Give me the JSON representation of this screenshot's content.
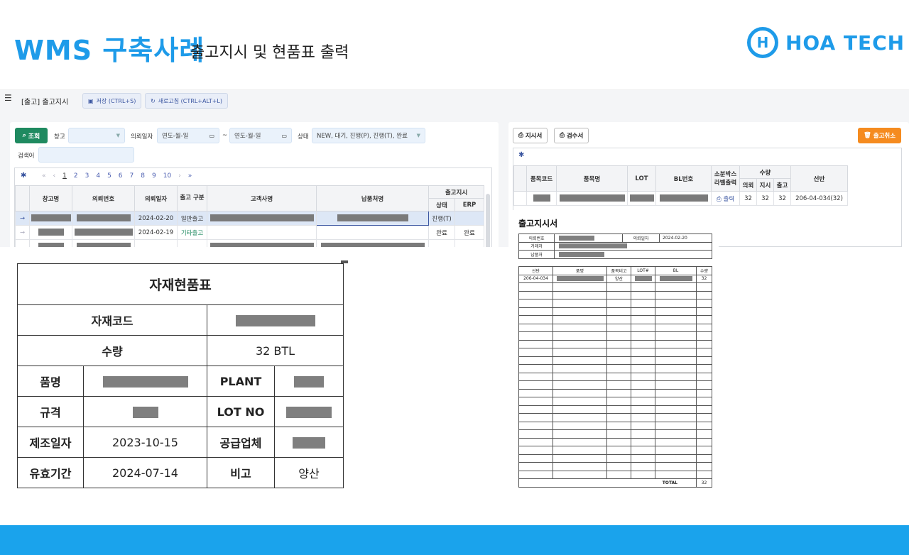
{
  "header": {
    "title_main": "WMS 구축사례",
    "title_sub": "출고지시 및 현품표 출력",
    "logo_mark": "H",
    "logo_text": "HOA TECH"
  },
  "app": {
    "menu_icon": "☰",
    "screen_title": "[출고] 출고지시",
    "save_label": "저장 (CTRL+S)",
    "refresh_label": "새로고침 (CTRL+ALT+L)",
    "search_button": "조회",
    "warehouse_label": "창고",
    "request_date_label": "의뢰일자",
    "date_placeholder_from": "연도-월-일",
    "date_tilde": "~",
    "date_placeholder_to": "연도-월-일",
    "status_label": "상태",
    "status_value": "NEW, 대기, 진행(P), 진행(T), 완료",
    "keyword_label": "검색어",
    "pager": {
      "first": "«",
      "prev": "‹",
      "pages": [
        "1",
        "2",
        "3",
        "4",
        "5",
        "6",
        "7",
        "8",
        "9",
        "10"
      ],
      "next": "›",
      "last": "»"
    },
    "left_table": {
      "headers": {
        "warehouse": "창고명",
        "request_no": "의뢰번호",
        "request_date": "의뢰일자",
        "ship_type": "출고 구분",
        "customer": "고객사명",
        "delivery": "납품처명",
        "ship_instr": "출고지시",
        "status": "상태",
        "erp": "ERP"
      },
      "rows": [
        {
          "date": "2024-02-20",
          "type": "일반출고",
          "status": "진행(T)",
          "erp": ""
        },
        {
          "date": "2024-02-19",
          "type": "기타출고",
          "status": "완료",
          "erp": "완료"
        }
      ]
    },
    "right_buttons": {
      "instr_print": "지시서",
      "inspect_print": "검수서",
      "cancel": "출고취소"
    },
    "right_table": {
      "headers": {
        "code": "품목코드",
        "name": "품목명",
        "lot": "LOT",
        "bl": "BL번호",
        "small_box": "소분박스 라벨출력",
        "qty": "수량",
        "req": "의뢰",
        "ins": "지시",
        "out": "출고",
        "shelf": "선반"
      },
      "row": {
        "print": "출력",
        "req": "32",
        "ins": "32",
        "out": "32",
        "shelf": "206-04-034(32)"
      }
    }
  },
  "material_label": {
    "title": "자재현품표",
    "code_label": "자재코드",
    "qty_label": "수량",
    "qty_value": "32 BTL",
    "name_label": "품명",
    "plant_label": "PLANT",
    "spec_label": "규격",
    "lot_label": "LOT NO",
    "mfg_label": "제조일자",
    "mfg_value": "2023-10-15",
    "supplier_label": "공급업체",
    "expiry_label": "유효기간",
    "expiry_value": "2024-07-14",
    "remark_label": "비고",
    "remark_value": "양산"
  },
  "order_sheet": {
    "title": "출고지시서",
    "req_no_label": "의뢰번호",
    "req_date_label": "의뢰일자",
    "req_date_value": "2024-02-20",
    "client_label": "거래처",
    "dest_label": "납품처",
    "cols": [
      "선반",
      "품명",
      "품목비고",
      "LOT#",
      "BL",
      "수량"
    ],
    "first_row": {
      "shelf": "206-04-034",
      "remark": "양산",
      "qty": "32"
    },
    "total_label": "TOTAL",
    "total_value": "32"
  },
  "colors": {
    "brand": "#1e9be9",
    "footer": "#1aa3ec",
    "green": "#1f8a60",
    "orange": "#f58b1f"
  }
}
